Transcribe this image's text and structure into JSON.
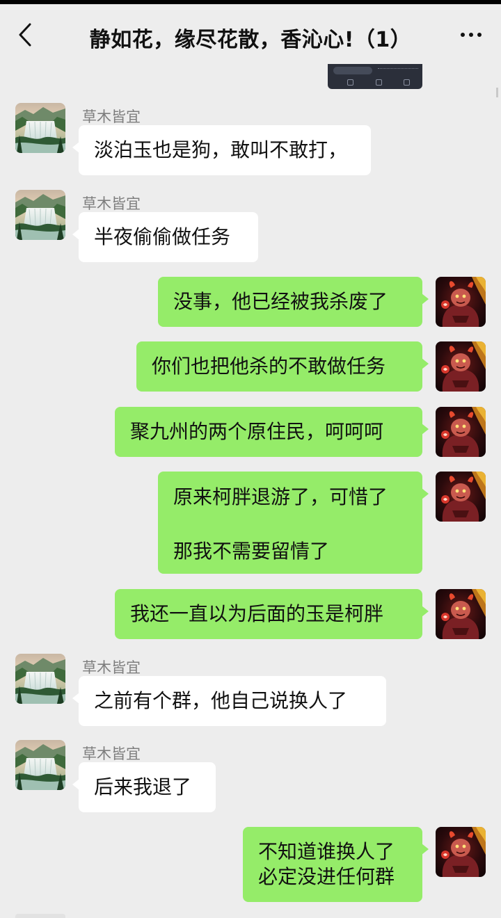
{
  "header": {
    "title": "静如花，缘尽花散，香沁心!（1）",
    "back_icon": "chevron-left-icon",
    "more_icon": "more-horizontal-icon"
  },
  "colors": {
    "background": "#ededed",
    "bubble_self": "#95ec69",
    "bubble_other": "#ffffff",
    "sender_name": "#7d7d7d"
  },
  "messages": [
    {
      "side": "left",
      "sender": "草木皆宜",
      "avatar": "waterfall-landscape-avatar",
      "lines": [
        "淡泊玉也是狗，敢叫不敢打，"
      ]
    },
    {
      "side": "left",
      "sender": "草木皆宜",
      "avatar": "waterfall-landscape-avatar",
      "lines": [
        "半夜偷偷做任务"
      ]
    },
    {
      "side": "right",
      "avatar": "demon-character-avatar",
      "lines": [
        "没事，他已经被我杀废了"
      ]
    },
    {
      "side": "right",
      "avatar": "demon-character-avatar",
      "lines": [
        "你们也把他杀的不敢做任务"
      ]
    },
    {
      "side": "right",
      "avatar": "demon-character-avatar",
      "lines": [
        "聚九州的两个原住民，呵呵呵"
      ]
    },
    {
      "side": "right",
      "avatar": "demon-character-avatar",
      "lines": [
        "原来柯胖退游了，可惜了",
        "那我不需要留情了"
      ]
    },
    {
      "side": "right",
      "avatar": "demon-character-avatar",
      "lines": [
        "我还一直以为后面的玉是柯胖"
      ]
    },
    {
      "side": "left",
      "sender": "草木皆宜",
      "avatar": "waterfall-landscape-avatar",
      "lines": [
        "之前有个群，他自己说换人了"
      ]
    },
    {
      "side": "left",
      "sender": "草木皆宜",
      "avatar": "waterfall-landscape-avatar",
      "lines": [
        "后来我退了"
      ]
    },
    {
      "side": "right",
      "avatar": "demon-character-avatar",
      "lines": [
        "不知道谁换人了",
        "必定没进任何群"
      ]
    }
  ]
}
